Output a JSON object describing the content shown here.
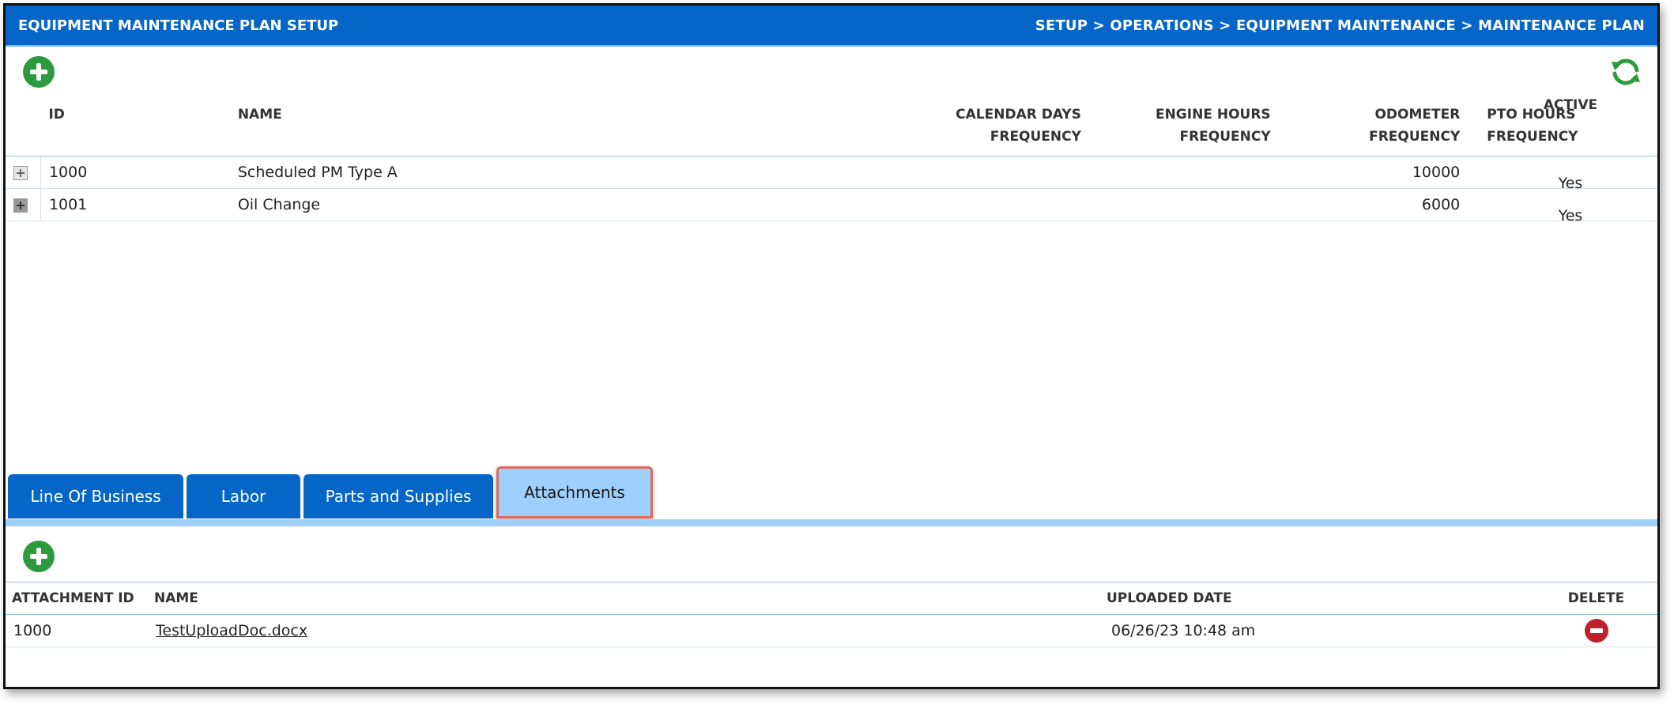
{
  "header": {
    "title": "EQUIPMENT MAINTENANCE PLAN SETUP",
    "breadcrumb": "SETUP > OPERATIONS > EQUIPMENT MAINTENANCE > MAINTENANCE PLAN"
  },
  "toolbar": {
    "add_icon": "add-icon",
    "refresh_icon": "refresh-icon"
  },
  "plans": {
    "columns": {
      "id": "ID",
      "name": "NAME",
      "calendar_days_frequency": "CALENDAR DAYS FREQUENCY",
      "engine_hours_frequency": "ENGINE HOURS FREQUENCY",
      "odometer_frequency": "ODOMETER FREQUENCY",
      "pto_hours_frequency": "PTO HOURS FREQUENCY",
      "active": "ACTIVE"
    },
    "rows": [
      {
        "id": "1000",
        "name": "Scheduled PM Type A",
        "calendar_days": "",
        "engine_hours": "",
        "odometer": "10000",
        "pto_hours": "",
        "active": "Yes"
      },
      {
        "id": "1001",
        "name": "Oil Change",
        "calendar_days": "",
        "engine_hours": "",
        "odometer": "6000",
        "pto_hours": "",
        "active": "Yes"
      }
    ]
  },
  "tabs": [
    {
      "label": "Line Of Business"
    },
    {
      "label": "Labor"
    },
    {
      "label": "Parts and Supplies"
    },
    {
      "label": "Attachments",
      "active": true
    }
  ],
  "attachments": {
    "columns": {
      "attachment_id": "ATTACHMENT ID",
      "name": "NAME",
      "uploaded_date": "UPLOADED DATE",
      "delete": "DELETE"
    },
    "rows": [
      {
        "attachment_id": "1000",
        "name": "TestUploadDoc.docx",
        "uploaded_date": "06/26/23 10:48 am"
      }
    ]
  },
  "colors": {
    "header_blue": "#0566c8",
    "active_tab": "#9fd0fb",
    "add_green": "#2c9a3d",
    "delete_red": "#c0202e",
    "highlight": "#e06b5f"
  }
}
